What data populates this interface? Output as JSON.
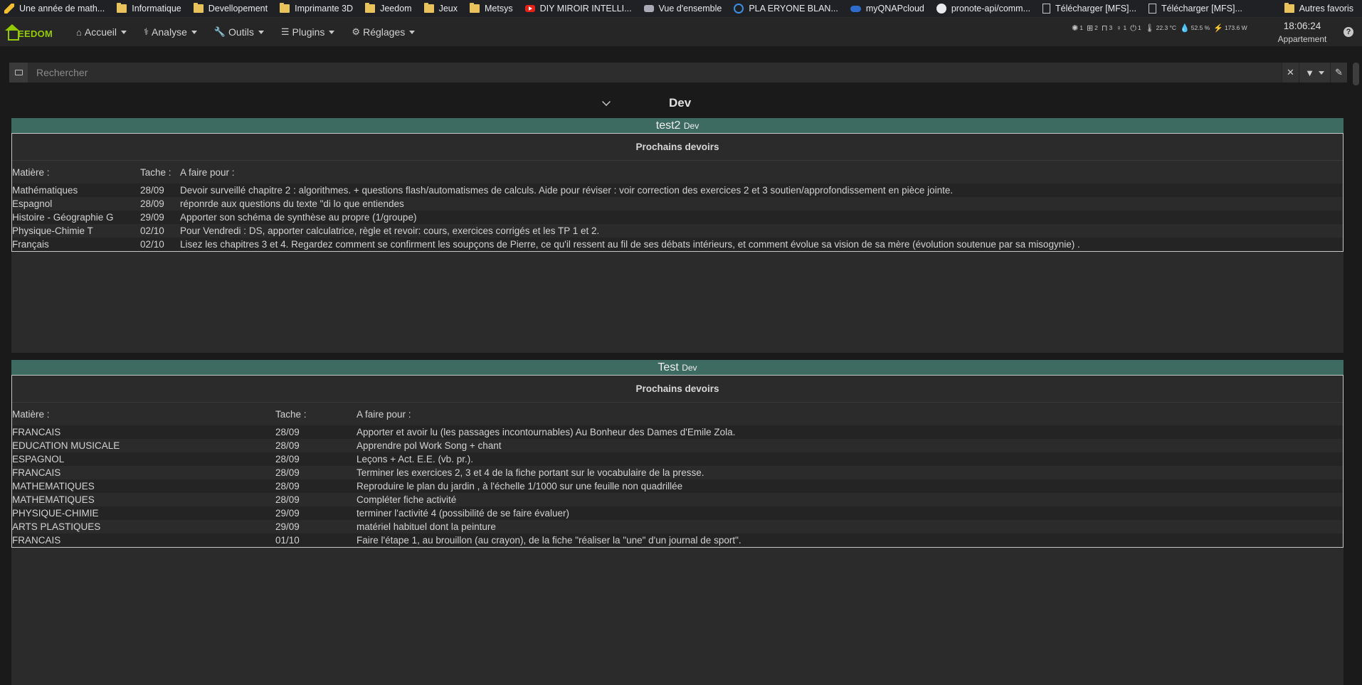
{
  "bookmarks": [
    {
      "label": "Une année de math...",
      "icon": "pen-icon"
    },
    {
      "label": "Informatique",
      "icon": "folder-icon"
    },
    {
      "label": "Devellopement",
      "icon": "folder-icon"
    },
    {
      "label": "Imprimante 3D",
      "icon": "folder-icon"
    },
    {
      "label": "Jeedom",
      "icon": "folder-icon"
    },
    {
      "label": "Jeux",
      "icon": "folder-icon"
    },
    {
      "label": "Metsys",
      "icon": "folder-icon"
    },
    {
      "label": "DIY MIROIR INTELLI...",
      "icon": "youtube-icon"
    },
    {
      "label": "Vue d'ensemble",
      "icon": "car-icon"
    },
    {
      "label": "PLA ERYONE BLAN...",
      "icon": "globe-icon"
    },
    {
      "label": "myQNAPcloud",
      "icon": "cloud-icon"
    },
    {
      "label": "pronote-api/comm...",
      "icon": "github-icon"
    },
    {
      "label": "Télécharger [MFS]...",
      "icon": "document-icon"
    },
    {
      "label": "Télécharger [MFS]...",
      "icon": "document-icon"
    }
  ],
  "bookmarks_other": "Autres favoris",
  "logo": {
    "text": "EEDOM"
  },
  "menu": {
    "accueil": "Accueil",
    "analyse": "Analyse",
    "outils": "Outils",
    "plugins": "Plugins",
    "reglages": "Réglages"
  },
  "summary": {
    "lights": "1",
    "windows": "2",
    "doors": "3",
    "motion": "1",
    "outlets": "1",
    "temperature": "22.3 °C",
    "humidity": "52.5 %",
    "power": "173.6 W"
  },
  "clock": {
    "time": "18:06:24",
    "place": "Appartement"
  },
  "search": {
    "placeholder": "Rechercher"
  },
  "object": {
    "title": "Dev"
  },
  "widgets": [
    {
      "name": "test2",
      "object": "Dev",
      "subtitle": "Prochains devoirs",
      "col_matiere": "Matière :",
      "col_tache": "Tache :",
      "col_afaire": "A faire pour :",
      "rows": [
        [
          "Mathématiques",
          "28/09",
          "Devoir surveillé chapitre 2 : algorithmes. + questions flash/automatismes de calculs. Aide pour réviser : voir correction des exercices 2 et 3 soutien/approfondissement en pièce jointe."
        ],
        [
          "Espagnol",
          "28/09",
          "réponrde aux questions du texte \"di lo que entiendes"
        ],
        [
          "Histoire - Géographie G",
          "29/09",
          "Apporter son schéma de synthèse au propre (1/groupe)"
        ],
        [
          "Physique-Chimie T",
          "02/10",
          "Pour Vendredi : DS, apporter calculatrice, règle et revoir: cours, exercices corrigés et les TP 1 et 2."
        ],
        [
          "Français",
          "02/10",
          "Lisez les chapitres 3 et 4. Regardez comment se confirment les soupçons de Pierre, ce qu'il ressent au fil de ses débats intérieurs, et comment évolue sa vision de sa mère (évolution soutenue par sa misogynie) ."
        ]
      ]
    },
    {
      "name": "Test",
      "object": "Dev",
      "subtitle": "Prochains devoirs",
      "col_matiere": "Matière :",
      "col_tache": "Tache :",
      "col_afaire": "A faire pour :",
      "rows": [
        [
          "FRANCAIS",
          "28/09",
          "Apporter et avoir lu (les passages incontournables) Au Bonheur des Dames d'Emile Zola."
        ],
        [
          "EDUCATION MUSICALE",
          "28/09",
          "Apprendre pol Work Song + chant"
        ],
        [
          "ESPAGNOL",
          "28/09",
          "Leçons + Act. E.E. (vb. pr.)."
        ],
        [
          "FRANCAIS",
          "28/09",
          "Terminer les exercices 2, 3 et 4 de la fiche portant sur le vocabulaire de la presse."
        ],
        [
          "MATHEMATIQUES",
          "28/09",
          "Reproduire le plan du jardin , à l'échelle 1/1000 sur une feuille non quadrillée"
        ],
        [
          "MATHEMATIQUES",
          "28/09",
          "Compléter fiche activité"
        ],
        [
          "PHYSIQUE-CHIMIE",
          "29/09",
          "terminer l'activité 4 (possibilité de se faire évaluer)"
        ],
        [
          "ARTS PLASTIQUES",
          "29/09",
          "matériel habituel dont la peinture"
        ],
        [
          "FRANCAIS",
          "01/10",
          "Faire l'étape 1, au brouillon (au crayon), de la fiche \"réaliser la \"une\" d'un journal de sport\"."
        ]
      ]
    }
  ]
}
